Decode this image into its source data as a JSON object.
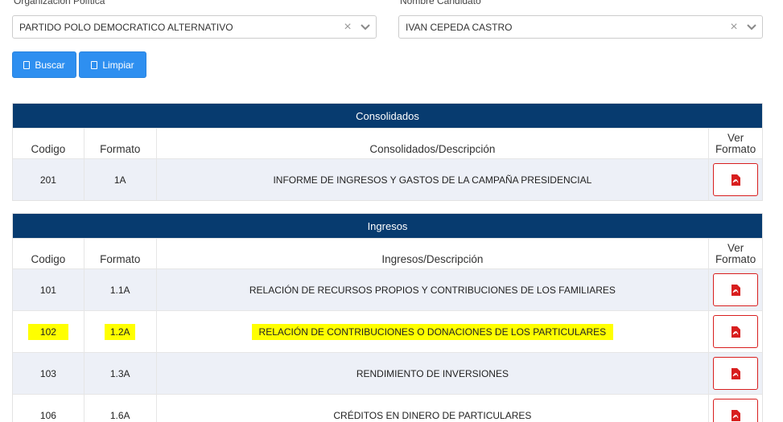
{
  "filters": {
    "org_label": "Organización Política",
    "org_value": "PARTIDO POLO DEMOCRATICO ALTERNATIVO",
    "candidate_label": "Nombre Candidato",
    "candidate_value": "IVAN CEPEDA CASTRO",
    "clear_symbol": "×"
  },
  "buttons": {
    "search": "Buscar",
    "clear": "Limpiar"
  },
  "consolidados": {
    "title": "Consolidados",
    "headers": {
      "code": "Codigo",
      "format": "Formato",
      "desc": "Consolidados/Descripción",
      "view1": "Ver",
      "view2": "Formato"
    },
    "rows": [
      {
        "code": "201",
        "format": "1A",
        "desc": "INFORME DE INGRESOS Y GASTOS DE LA CAMPAÑA PRESIDENCIAL"
      }
    ]
  },
  "ingresos": {
    "title": "Ingresos",
    "headers": {
      "code": "Codigo",
      "format": "Formato",
      "desc": "Ingresos/Descripción",
      "view1": "Ver",
      "view2": "Formato"
    },
    "rows": [
      {
        "code": "101",
        "format": "1.1A",
        "desc": "RELACIÓN DE RECURSOS PROPIOS Y CONTRIBUCIONES DE LOS FAMILIARES"
      },
      {
        "code": "102",
        "format": "1.2A",
        "desc": "RELACIÓN DE CONTRIBUCIONES O DONACIONES DE LOS PARTICULARES"
      },
      {
        "code": "103",
        "format": "1.3A",
        "desc": "RENDIMIENTO DE INVERSIONES"
      },
      {
        "code": "106",
        "format": "1.6A",
        "desc": "CRÉDITOS EN DINERO DE PARTICULARES"
      }
    ]
  },
  "colors": {
    "header_bg": "#073b6f",
    "button_bg": "#2e8ff0",
    "pdf_red": "#d81e1e",
    "highlight": "#ffff00",
    "alt_row": "#edf0f7"
  },
  "icons": {
    "pdf": "pdf-file-icon",
    "search": "search-icon",
    "clear": "eraser-icon",
    "dropdown": "chevron-down-icon"
  }
}
